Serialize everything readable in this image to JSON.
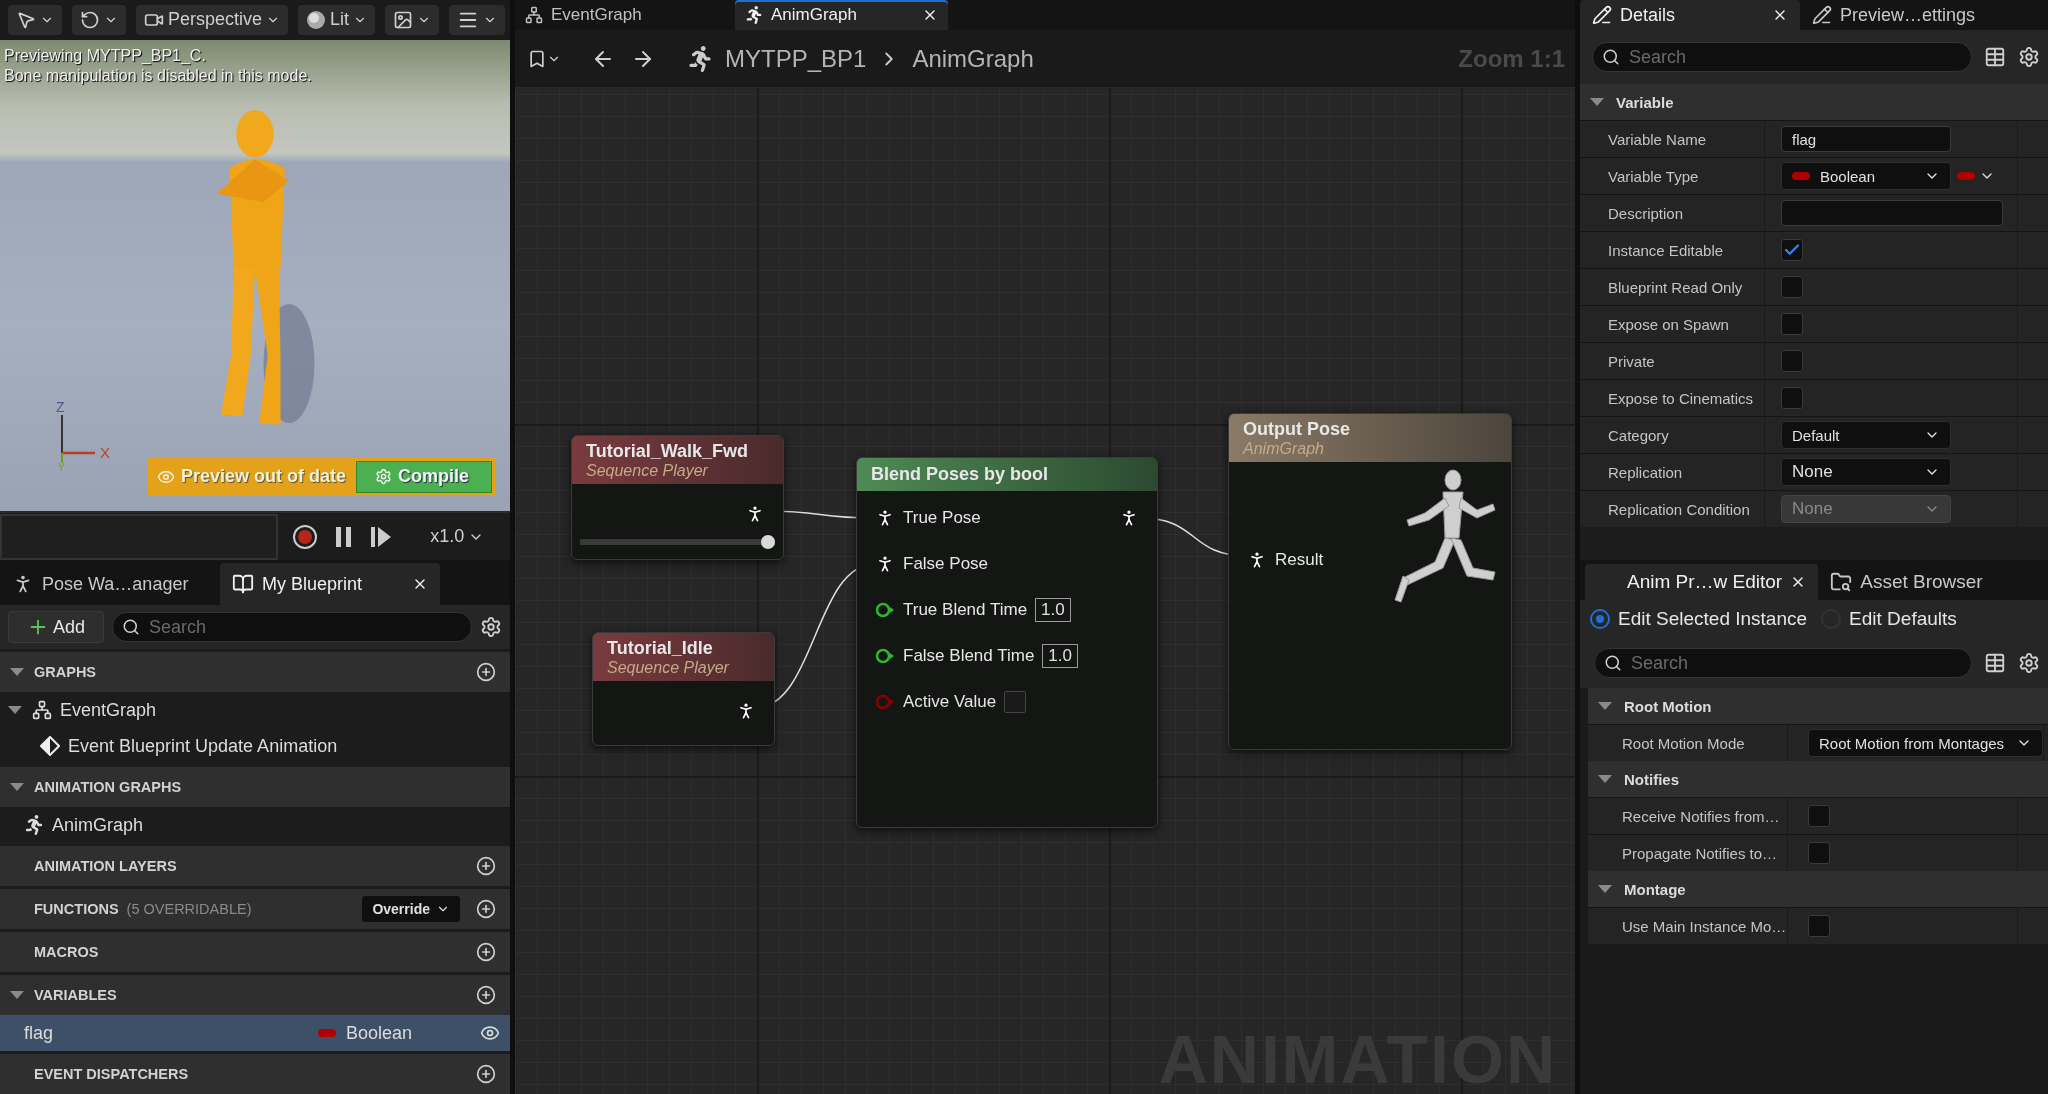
{
  "viewport": {
    "toolbar": {
      "view_mode": "Perspective",
      "lighting": "Lit"
    },
    "overlay_lines": [
      "Previewing MYTPP_BP1_C.",
      "Bone manipulation is disabled in this mode."
    ],
    "axes": [
      "Z",
      "X",
      "Y"
    ],
    "preview_status": "Preview out of date",
    "compile_button": "Compile",
    "playback": {
      "speed": "x1.0"
    }
  },
  "my_blueprint": {
    "tabs": [
      {
        "label": "Pose Wa…anager",
        "selected": false,
        "closable": false
      },
      {
        "label": "My Blueprint",
        "selected": true,
        "closable": true
      }
    ],
    "add_button": "Add",
    "search": {
      "placeholder": "Search"
    },
    "sections": [
      {
        "title": "GRAPHS",
        "expandable": true,
        "add": true,
        "items": [
          {
            "kind": "graph",
            "label": "EventGraph",
            "selected": false,
            "expanded": true,
            "children": [
              {
                "kind": "event",
                "label": "Event Blueprint Update Animation",
                "selected": false
              }
            ]
          }
        ]
      },
      {
        "title": "ANIMATION GRAPHS",
        "expandable": true,
        "add": false,
        "items": [
          {
            "kind": "anim",
            "label": "AnimGraph",
            "selected": false
          }
        ]
      },
      {
        "title": "ANIMATION LAYERS",
        "expandable": false,
        "add": true
      },
      {
        "title": "FUNCTIONS",
        "note": "(5 OVERRIDABLE)",
        "dropdown": "Override",
        "expandable": false,
        "add": true
      },
      {
        "title": "MACROS",
        "expandable": false,
        "add": true
      },
      {
        "title": "VARIABLES",
        "expandable": true,
        "add": true,
        "items": [
          {
            "kind": "variable",
            "label": "flag",
            "type": "Boolean",
            "selected": true
          }
        ]
      },
      {
        "title": "EVENT DISPATCHERS",
        "expandable": false,
        "add": true
      }
    ]
  },
  "graph": {
    "tabs": [
      {
        "kind": "graph",
        "label": "EventGraph",
        "selected": false,
        "closable": false
      },
      {
        "kind": "anim",
        "label": "AnimGraph",
        "selected": true,
        "closable": true
      }
    ],
    "breadcrumb": [
      "MYTPP_BP1",
      "AnimGraph"
    ],
    "zoom": "Zoom 1:1",
    "watermark": "ANIMATION",
    "nodes": [
      {
        "kind": "sequence",
        "title": "Tutorial_Walk_Fwd",
        "subtitle": "Sequence Player",
        "level": 1
      },
      {
        "kind": "sequence",
        "title": "Tutorial_Idle",
        "subtitle": "Sequence Player"
      },
      {
        "kind": "blend",
        "title": "Blend Poses by bool",
        "pins": [
          {
            "kind": "pose",
            "label": "True Pose"
          },
          {
            "kind": "pose",
            "label": "False Pose"
          },
          {
            "kind": "float",
            "label": "True Blend Time",
            "value": "1.0"
          },
          {
            "kind": "float",
            "label": "False Blend Time",
            "value": "1.0"
          },
          {
            "kind": "bool",
            "label": "Active Value",
            "checked": false
          }
        ]
      },
      {
        "kind": "output",
        "title": "Output Pose",
        "subtitle": "AnimGraph",
        "pins": [
          {
            "kind": "pose",
            "label": "Result"
          }
        ]
      }
    ]
  },
  "details": {
    "tabs": [
      {
        "label": "Details",
        "selected": true,
        "closable": true
      },
      {
        "label": "Preview…ettings",
        "selected": false,
        "closable": false
      }
    ],
    "search": {
      "placeholder": "Search"
    },
    "categories": [
      {
        "title": "Variable",
        "rows": [
          {
            "kind": "text",
            "label": "Variable Name",
            "value": "flag"
          },
          {
            "kind": "type",
            "label": "Variable Type",
            "value": "Boolean"
          },
          {
            "kind": "text",
            "label": "Description"
          },
          {
            "kind": "checkbox",
            "label": "Instance Editable",
            "checked": true
          },
          {
            "kind": "checkbox",
            "label": "Blueprint Read Only",
            "checked": false
          },
          {
            "kind": "checkbox",
            "label": "Expose on Spawn",
            "checked": false
          },
          {
            "kind": "checkbox",
            "label": "Private",
            "checked": false
          },
          {
            "kind": "checkbox",
            "label": "Expose to Cinematics",
            "checked": false
          },
          {
            "kind": "combo",
            "label": "Category",
            "value": "Default"
          },
          {
            "kind": "dropdown",
            "label": "Replication",
            "value": "None",
            "disabled": false
          },
          {
            "kind": "dropdown",
            "label": "Replication Condition",
            "value": "None",
            "disabled": true
          }
        ]
      }
    ]
  },
  "anim_preview": {
    "tabs": [
      {
        "label": "Anim Pr…w Editor",
        "selected": true,
        "closable": true
      },
      {
        "label": "Asset Browser",
        "selected": false,
        "closable": false
      }
    ],
    "radios": [
      {
        "label": "Edit Selected Instance",
        "selected": true
      },
      {
        "label": "Edit Defaults",
        "selected": false
      }
    ],
    "search": {
      "placeholder": "Search"
    },
    "categories": [
      {
        "title": "Root Motion",
        "rows": [
          {
            "kind": "dropdown",
            "label": "Root Motion Mode",
            "value": "Root Motion from Montages",
            "disabled": false
          }
        ]
      },
      {
        "title": "Notifies",
        "rows": [
          {
            "kind": "checkbox",
            "label": "Receive Notifies from…",
            "checked": false
          },
          {
            "kind": "checkbox",
            "label": "Propagate Notifies to…",
            "checked": false
          }
        ]
      },
      {
        "title": "Montage",
        "rows": [
          {
            "kind": "checkbox",
            "label": "Use Main Instance Mo…",
            "checked": false
          }
        ]
      }
    ]
  }
}
